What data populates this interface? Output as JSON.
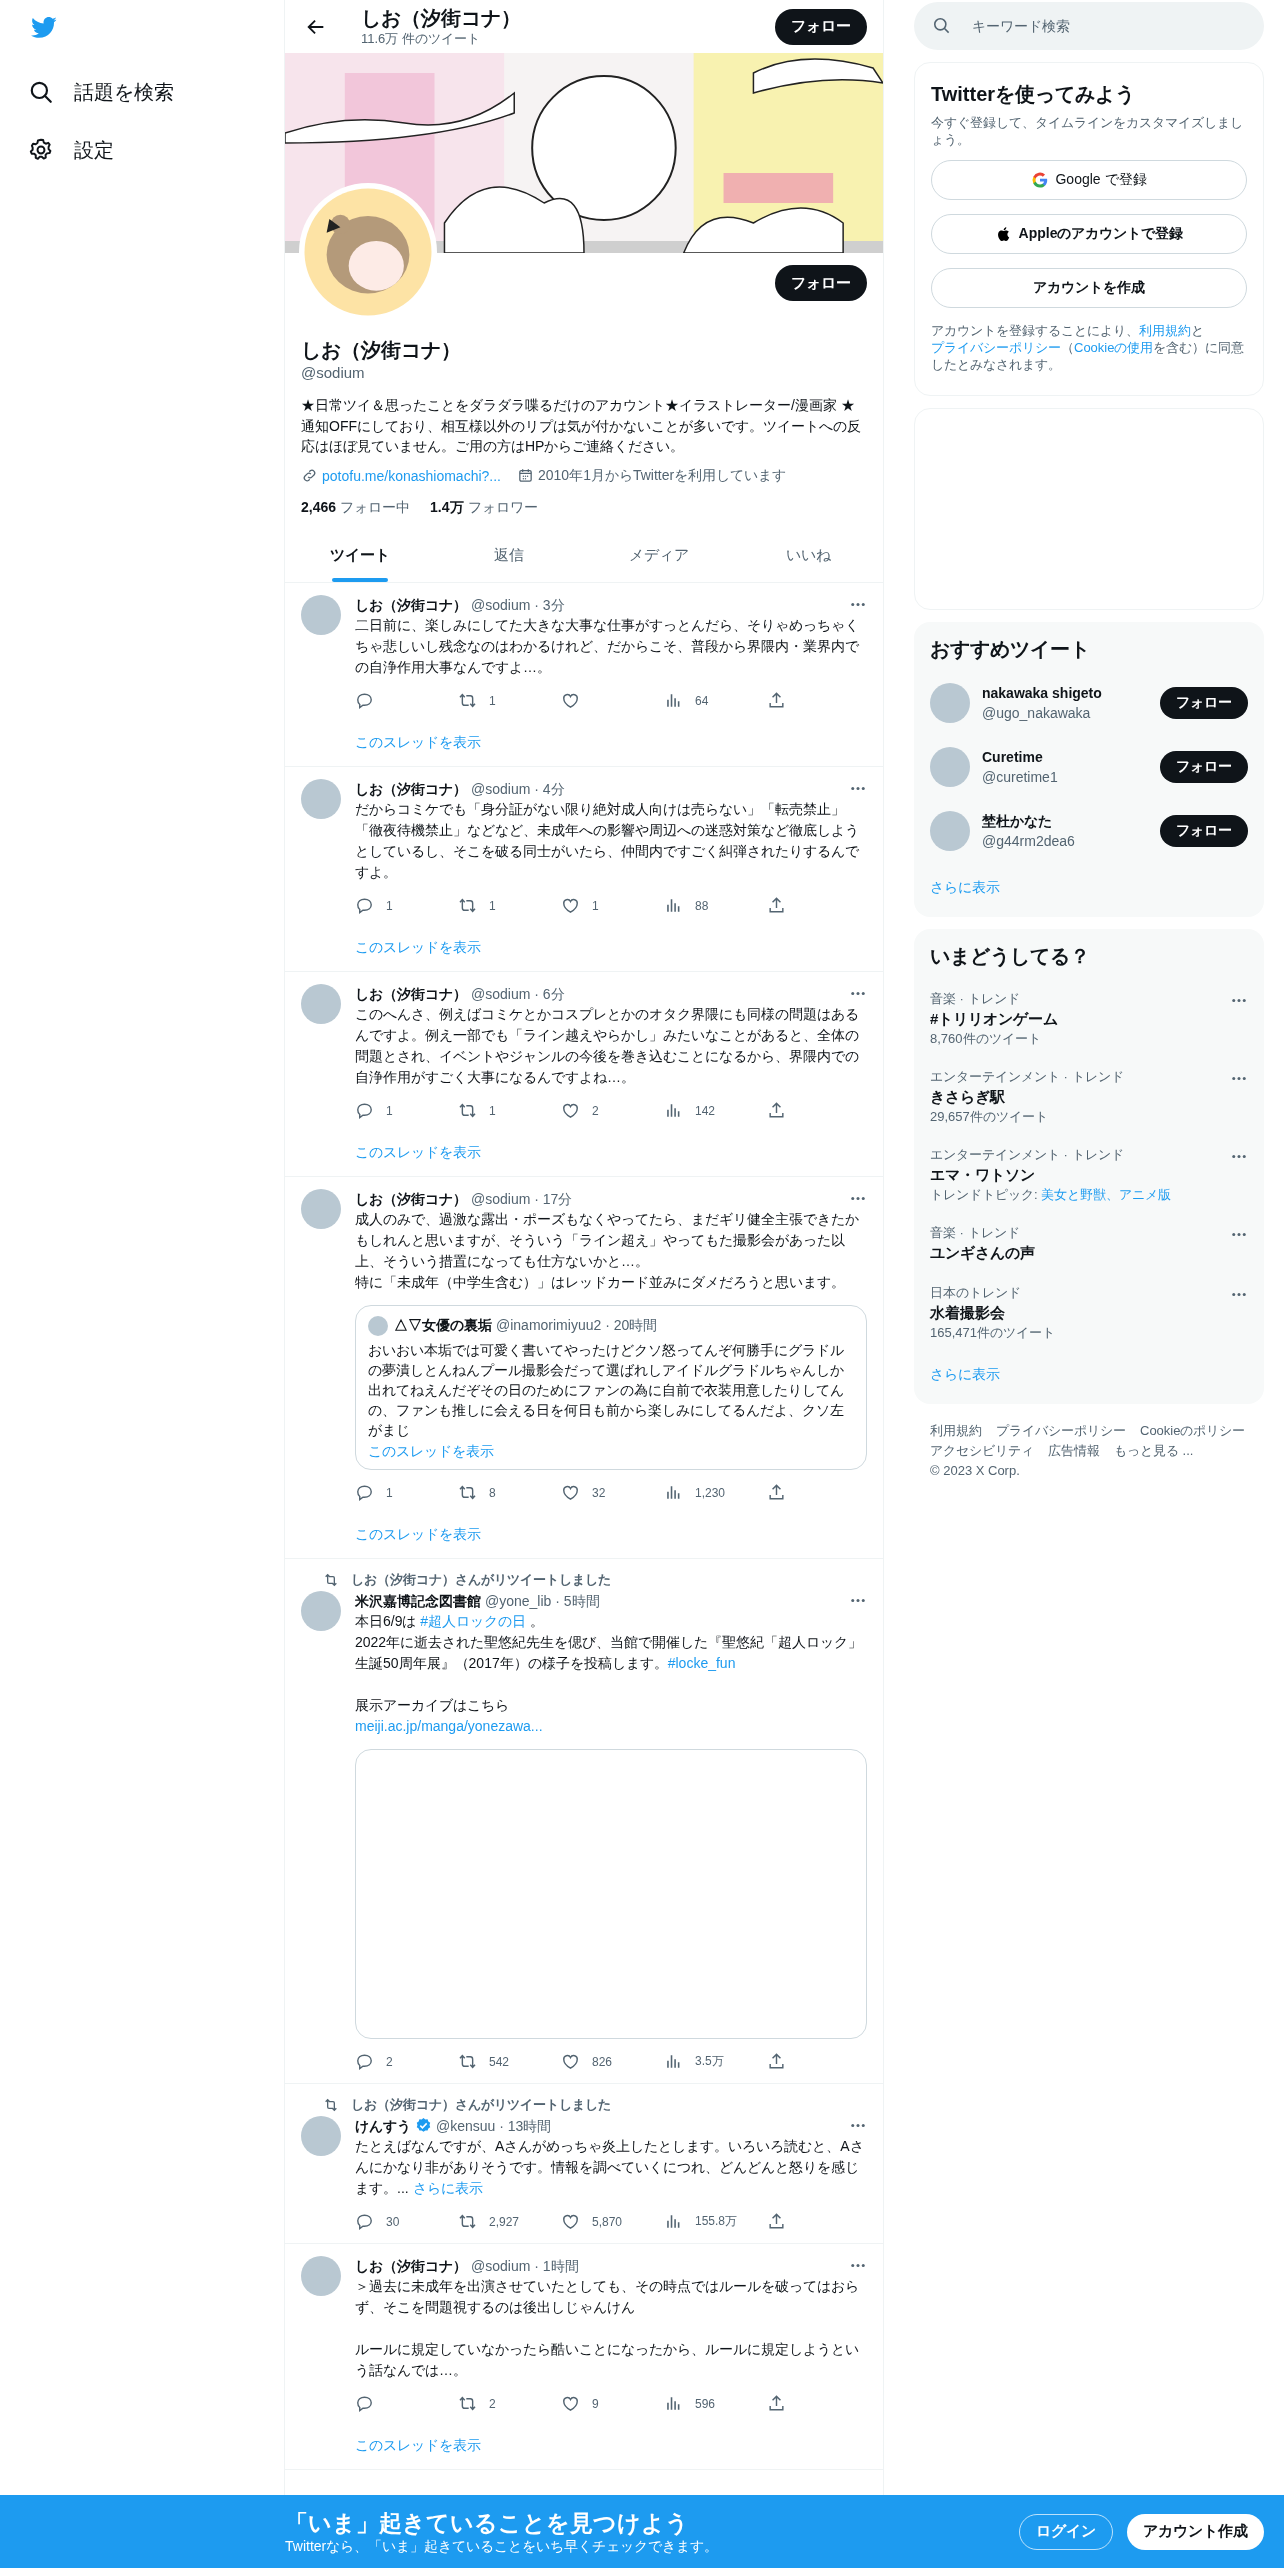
{
  "nav": [
    {
      "kind": "search",
      "label": "話題を検索"
    },
    {
      "kind": "settings",
      "label": "設定"
    }
  ],
  "header": {
    "title": "しお（汐街コナ）",
    "subtitle": "11.6万 件のツイート",
    "button": "フォロー"
  },
  "profile": {
    "button": "フォロー",
    "name": "しお（汐街コナ）",
    "handle": "@sodium",
    "bio": "★日常ツイ＆思ったことをダラダラ喋るだけのアカウント★イラストレーター/漫画家 ★通知OFFにしており、相互様以外のリプは気が付かないことが多いです。ツイートへの反応はほぼ見ていません。ご用の方はHPからご連絡ください。",
    "link": "potofu.me/konashiomachi?...",
    "joined": "2010年1月からTwitterを利用しています",
    "following_count": "2,466",
    "following_label": "フォロー中",
    "followers_count": "1.4万",
    "followers_label": "フォロワー"
  },
  "tabs": [
    {
      "label": "ツイート",
      "selected": true
    },
    {
      "label": "返信",
      "selected": false
    },
    {
      "label": "メディア",
      "selected": false
    },
    {
      "label": "いいね",
      "selected": false
    }
  ],
  "tweets": [
    {
      "name": "しお（汐街コナ）",
      "verified": false,
      "meta": "@sodium · 3分",
      "blocks": [
        {
          "lines": [
            [
              {
                "kind": "text",
                "text": "二日前に、楽しみにしてた大きな大事な仕事がすっとんだら、そりゃめっちゃくちゃ悲しいし残念なのはわかるけれど、だからこそ、普段から界隈内・業界内での自浄作用大事なんですよ…。"
              }
            ]
          ]
        }
      ],
      "actions": [
        {
          "kind": "reply"
        },
        {
          "kind": "retweet",
          "count": "1"
        },
        {
          "kind": "like"
        },
        {
          "kind": "views",
          "count": "64"
        },
        {
          "kind": "share"
        }
      ],
      "thread_link": "このスレッドを表示"
    },
    {
      "name": "しお（汐街コナ）",
      "verified": false,
      "meta": "@sodium · 4分",
      "blocks": [
        {
          "lines": [
            [
              {
                "kind": "text",
                "text": "だからコミケでも「身分証がない限り絶対成人向けは売らない」「転売禁止」「徹夜待機禁止」などなど、未成年への影響や周辺への迷惑対策など徹底しようとしているし、そこを破る同士がいたら、仲間内ですごく糾弾されたりするんですよ。"
              }
            ]
          ]
        }
      ],
      "actions": [
        {
          "kind": "reply",
          "count": "1"
        },
        {
          "kind": "retweet",
          "count": "1"
        },
        {
          "kind": "like",
          "count": "1"
        },
        {
          "kind": "views",
          "count": "88"
        },
        {
          "kind": "share"
        }
      ],
      "thread_link": "このスレッドを表示"
    },
    {
      "name": "しお（汐街コナ）",
      "verified": false,
      "meta": "@sodium · 6分",
      "blocks": [
        {
          "lines": [
            [
              {
                "kind": "text",
                "text": "このへんさ、例えばコミケとかコスプレとかのオタク界隈にも同様の問題はあるんですよ。例え一部でも「ライン越えやらかし」みたいなことがあると、全体の問題とされ、イベントやジャンルの今後を巻き込むことになるから、界隈内での自浄作用がすごく大事になるんですよね…。"
              }
            ]
          ]
        }
      ],
      "actions": [
        {
          "kind": "reply",
          "count": "1"
        },
        {
          "kind": "retweet",
          "count": "1"
        },
        {
          "kind": "like",
          "count": "2"
        },
        {
          "kind": "views",
          "count": "142"
        },
        {
          "kind": "share"
        }
      ],
      "thread_link": "このスレッドを表示"
    },
    {
      "name": "しお（汐街コナ）",
      "verified": false,
      "meta": "@sodium · 17分",
      "blocks": [
        {
          "lines": [
            [
              {
                "kind": "text",
                "text": "成人のみで、過激な露出・ポーズもなくやってたら、まだギリ健全主張できたかもしれんと思いますが、そういう「ライン超え」やってもた撮影会があった以上、そういう措置になっても仕方ないかと…。"
              }
            ],
            [
              {
                "kind": "text",
                "text": "特に「未成年（中学生含む）」はレッドカード並みにダメだろうと思います。"
              }
            ]
          ]
        }
      ],
      "quote": {
        "name": "△▽女優の裏垢",
        "meta": "@inamorimiyuu2 · 20時間",
        "text": "おいおい本垢では可愛く書いてやったけどクソ怒ってんぞ何勝手にグラドルの夢潰しとんねんプール撮影会だって選ばれしアイドルグラドルちゃんしか出れてねえんだぞその日のためにファンの為に自前で衣装用意したりしてんの、ファンも推しに会える日を何日も前から楽しみにしてるんだよ、クソ左がまじ",
        "link": "このスレッドを表示"
      },
      "actions": [
        {
          "kind": "reply",
          "count": "1"
        },
        {
          "kind": "retweet",
          "count": "8"
        },
        {
          "kind": "like",
          "count": "32"
        },
        {
          "kind": "views",
          "count": "1,230"
        },
        {
          "kind": "share"
        }
      ],
      "thread_link": "このスレッドを表示"
    },
    {
      "retweeted_by": "しお（汐街コナ）さんがリツイートしました",
      "name": "米沢嘉博記念図書館",
      "verified": false,
      "meta": "@yone_lib · 5時間",
      "blocks": [
        {
          "lines": [
            [
              {
                "kind": "text",
                "text": "本日6/9は "
              },
              {
                "kind": "link",
                "text": "#超人ロックの日"
              },
              {
                "kind": "text",
                "text": " 。"
              }
            ],
            [
              {
                "kind": "text",
                "text": "2022年に逝去された聖悠紀先生を偲び、当館で開催した『聖悠紀「超人ロック」生誕50周年展』（2017年）の様子を投稿します。"
              },
              {
                "kind": "link",
                "text": "#locke_fun"
              }
            ]
          ]
        },
        {
          "lines": [
            [
              {
                "kind": "text",
                "text": "展示アーカイブはこちら"
              }
            ],
            [
              {
                "kind": "link",
                "text": "meiji.ac.jp/manga/yonezawa..."
              }
            ]
          ]
        }
      ],
      "link_card": true,
      "actions": [
        {
          "kind": "reply",
          "count": "2"
        },
        {
          "kind": "retweet",
          "count": "542"
        },
        {
          "kind": "like",
          "count": "826"
        },
        {
          "kind": "views",
          "count": "3.5万"
        },
        {
          "kind": "share"
        }
      ]
    },
    {
      "retweeted_by": "しお（汐街コナ）さんがリツイートしました",
      "name": "けんすう",
      "verified": true,
      "meta": "@kensuu · 13時間",
      "blocks": [
        {
          "lines": [
            [
              {
                "kind": "text",
                "text": "たとえばなんですが、Aさんがめっちゃ炎上したとします。いろいろ読むと、Aさんにかなり非がありそうです。情報を調べていくにつれ、どんどんと怒りを感じます。... "
              },
              {
                "kind": "link",
                "text": "さらに表示"
              }
            ]
          ]
        }
      ],
      "actions": [
        {
          "kind": "reply",
          "count": "30"
        },
        {
          "kind": "retweet",
          "count": "2,927"
        },
        {
          "kind": "like",
          "count": "5,870"
        },
        {
          "kind": "views",
          "count": "155.8万"
        },
        {
          "kind": "share"
        }
      ]
    },
    {
      "name": "しお（汐街コナ）",
      "verified": false,
      "meta": "@sodium · 1時間",
      "blocks": [
        {
          "lines": [
            [
              {
                "kind": "text",
                "text": "＞過去に未成年を出演させていたとしても、その時点ではルールを破ってはおらず、そこを問題視するのは後出しじゃんけん"
              }
            ]
          ]
        },
        {
          "lines": [
            [
              {
                "kind": "text",
                "text": "ルールに規定していなかったら酷いことになったから、ルールに規定しようという話なんでは…。"
              }
            ]
          ]
        }
      ],
      "actions": [
        {
          "kind": "reply"
        },
        {
          "kind": "retweet",
          "count": "2"
        },
        {
          "kind": "like",
          "count": "9"
        },
        {
          "kind": "views",
          "count": "596"
        },
        {
          "kind": "share"
        }
      ],
      "thread_link": "このスレッドを表示"
    }
  ],
  "sidebar": {
    "search": {
      "placeholder": "キーワード検索"
    },
    "signup": {
      "title": "Twitterを使ってみよう",
      "subtitle": "今すぐ登録して、タイムラインをカスタマイズしましょう。",
      "buttons": [
        {
          "kind": "google",
          "label": "Google で登録"
        },
        {
          "kind": "apple",
          "label": "Appleのアカウントで登録"
        },
        {
          "kind": "plain",
          "label": "アカウントを作成"
        }
      ],
      "legal": [
        {
          "kind": "text",
          "text": "アカウントを登録することにより、"
        },
        {
          "kind": "link",
          "text": "利用規約"
        },
        {
          "kind": "text",
          "text": "と"
        },
        {
          "kind": "link",
          "text": "プライバシーポリシー"
        },
        {
          "kind": "text",
          "text": "（"
        },
        {
          "kind": "link",
          "text": "Cookieの使用"
        },
        {
          "kind": "text",
          "text": "を含む）に同意したとみなされます。"
        }
      ]
    },
    "recommend": {
      "title": "おすすめツイート",
      "users": [
        {
          "name": "nakawaka shigeto",
          "handle": "@ugo_nakawaka",
          "button": "フォロー"
        },
        {
          "name": "Curetime",
          "handle": "@curetime1",
          "button": "フォロー"
        },
        {
          "name": "埜杜かなた",
          "handle": "@g44rm2dea6",
          "button": "フォロー"
        }
      ],
      "more": "さらに表示"
    },
    "trends": {
      "title": "いまどうしてる？",
      "items": [
        {
          "context": "音楽 · トレンド",
          "name": "#トリリオンゲーム",
          "detail": [
            {
              "kind": "text",
              "text": "8,760件のツイート"
            }
          ]
        },
        {
          "context": "エンターテインメント · トレンド",
          "name": "きさらぎ駅",
          "detail": [
            {
              "kind": "text",
              "text": "29,657件のツイート"
            }
          ]
        },
        {
          "context": "エンターテインメント · トレンド",
          "name": "エマ・ワトソン",
          "detail": [
            {
              "kind": "text",
              "text": "トレンドトピック: "
            },
            {
              "kind": "link",
              "text": "美女と野獣、アニメ版"
            }
          ]
        },
        {
          "context": "音楽 · トレンド",
          "name": "ユンギさんの声"
        },
        {
          "context": "日本のトレンド",
          "name": "水着撮影会",
          "detail": [
            {
              "kind": "text",
              "text": "165,471件のツイート"
            }
          ]
        }
      ],
      "more": "さらに表示"
    },
    "footer": [
      "利用規約",
      "プライバシーポリシー",
      "Cookieのポリシー",
      "アクセシビリティ",
      "広告情報",
      "もっと見る ...",
      "© 2023 X Corp."
    ]
  },
  "bottom_banner": {
    "title": "「いま」起きていることを見つけよう",
    "subtitle": "Twitterなら、「いま」起きていることをいち早くチェックできます。",
    "login": "ログイン",
    "signup": "アカウント作成"
  }
}
